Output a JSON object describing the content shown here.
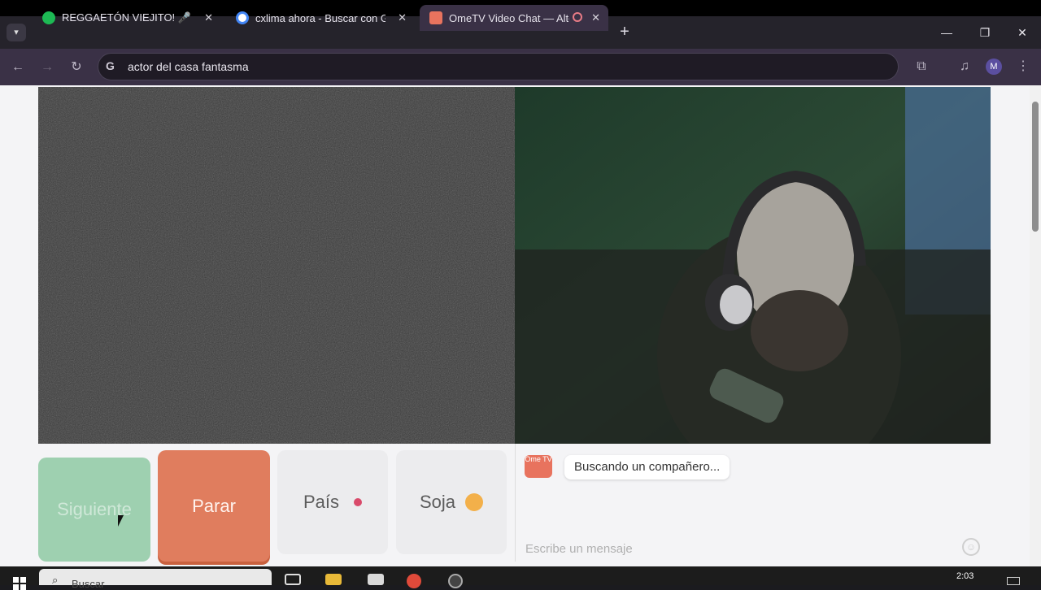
{
  "tabs": [
    {
      "title": "REGGAETÓN VIEJITO! 🎤🔥 - pl",
      "favicon": "spotify-icon",
      "color": "#1db954"
    },
    {
      "title": "cxlima ahora - Buscar con Goog",
      "favicon": "google-icon",
      "color": "#ffffff"
    },
    {
      "title": "OmeTV Video Chat — Alter",
      "favicon": "ometv-icon",
      "color": "#e8735e",
      "recording": true,
      "active": true
    }
  ],
  "toolbar": {
    "address": "actor del casa fantasma",
    "profile_initial": "M"
  },
  "controls": {
    "next_label": "Siguiente",
    "stop_label": "Parar",
    "country_label": "País",
    "gender_label": "Soja"
  },
  "chat": {
    "logo_text": "Ome TV",
    "status": "Buscando un compañero...",
    "input_placeholder": "Escribe un mensaje"
  },
  "taskbar": {
    "search_text": "Buscar",
    "time": "2:03"
  },
  "colors": {
    "accent_stop": "#e07d5e",
    "accent_next": "#9ed0b0",
    "country_dot": "#d94a6a"
  }
}
